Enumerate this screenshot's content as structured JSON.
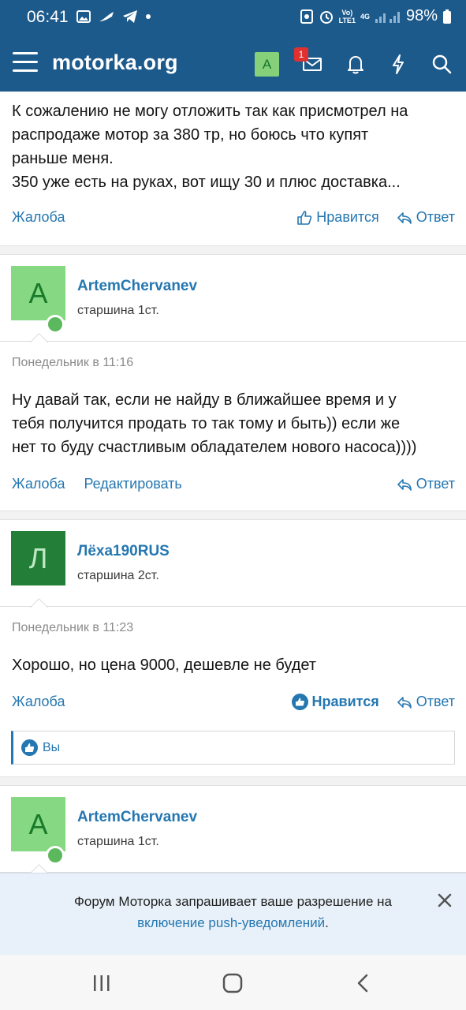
{
  "status_bar": {
    "time": "06:41",
    "network_top": "Vo)",
    "network_bottom": "LTE1",
    "net_type": "4G",
    "battery": "98%"
  },
  "header": {
    "site_title": "motorka.org",
    "avatar_letter": "A",
    "inbox_badge": "1"
  },
  "post_top": {
    "lines": [
      "К сожалению не могу отложить так как присмотрел на",
      "распродаже мотор за 380 тр, но боюсь что купят",
      "раньше меня.",
      "350 уже есть на руках, вот ищу 30 и плюс доставка..."
    ],
    "report": "Жалоба",
    "like": "Нравится",
    "reply": "Ответ"
  },
  "post_1": {
    "avatar_letter": "A",
    "username": "ArtemChervanev",
    "rank": "старшина 1ст.",
    "date": "Понедельник в 11:16",
    "lines": [
      "Ну давай так, если не найду в ближайшее время и у",
      "тебя получится продать то так тому и быть)) если же",
      "нет то буду счастливым обладателем нового насоса))))"
    ],
    "report": "Жалоба",
    "edit": "Редактировать",
    "reply": "Ответ"
  },
  "post_2": {
    "avatar_letter": "Л",
    "username": "Лёха190RUS",
    "rank": "старшина 2ст.",
    "date": "Понедельник в 11:23",
    "lines": [
      "Хорошо, но цена 9000, дешевле не будет"
    ],
    "report": "Жалоба",
    "like": "Нравится",
    "reply": "Ответ",
    "likes_by": "Вы"
  },
  "post_3": {
    "avatar_letter": "A",
    "username": "ArtemChervanev",
    "rank": "старшина 1ст."
  },
  "push": {
    "line1": "Форум Моторка запрашивает ваше разрешение на",
    "link": "включение push-уведомлений",
    "suffix": "."
  },
  "colors": {
    "brand": "#1d5a8c",
    "link": "#2577b1",
    "online": "#5cb85c"
  }
}
